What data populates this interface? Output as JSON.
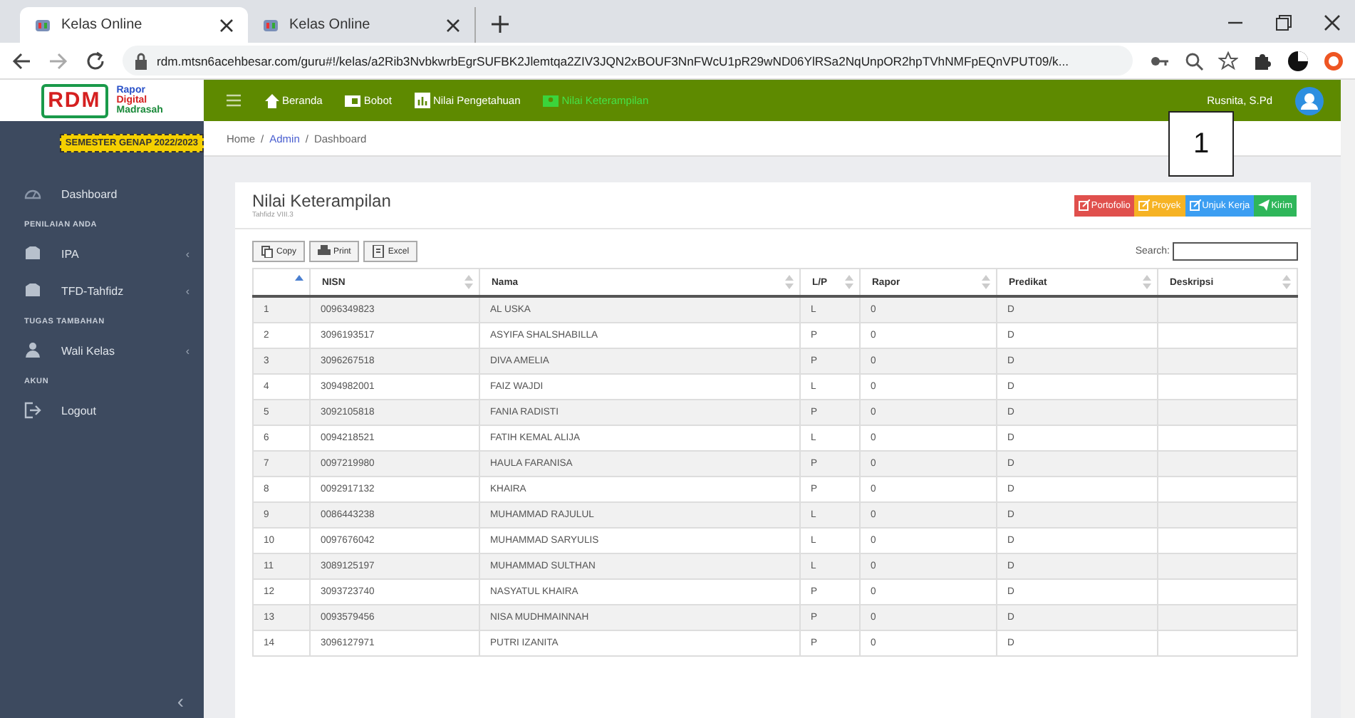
{
  "browser": {
    "tabs": [
      {
        "title": "Kelas Online",
        "selected": true
      },
      {
        "title": "Kelas Online",
        "selected": false
      }
    ],
    "url": "rdm.mtsn6acehbesar.com/guru#!/kelas/a2Rib3NvbkwrbEgrSUFBK2Jlemtqa2ZIV3JQN2xBOUF3NnFWcU1pR29wND06YlRSa2NqUnpOR2hpTVhNMFpEQnVPUT09/k..."
  },
  "header": {
    "logo_letters": "RDM",
    "logo_lines": [
      "Rapor",
      "Digital",
      "Madrasah"
    ],
    "nav": [
      {
        "label": "Beranda",
        "selected": false
      },
      {
        "label": "Bobot",
        "selected": false
      },
      {
        "label": "Nilai Pengetahuan",
        "selected": false
      },
      {
        "label": "Nilai Keterampilan",
        "selected": true
      }
    ],
    "user": "Rusnita, S.Pd"
  },
  "sidebar": {
    "semester": "SEMESTER GENAP 2022/2023",
    "items": [
      {
        "kind": "link",
        "label": "Dashboard"
      },
      {
        "kind": "section",
        "label": "PENILAIAN ANDA"
      },
      {
        "kind": "group",
        "label": "IPA",
        "chevron": "‹"
      },
      {
        "kind": "group",
        "label": "TFD-Tahfidz",
        "chevron": "‹"
      },
      {
        "kind": "section",
        "label": "TUGAS TAMBAHAN"
      },
      {
        "kind": "group",
        "label": "Wali Kelas",
        "chevron": "‹"
      },
      {
        "kind": "section",
        "label": "AKUN"
      },
      {
        "kind": "logout",
        "label": "Logout"
      }
    ],
    "collapse": "‹"
  },
  "breadcrumb": {
    "items": [
      "Home",
      "Admin",
      "Dashboard"
    ],
    "separator": "/"
  },
  "callout": "1",
  "card": {
    "title": "Nilai Keterampilan",
    "subtitle": "Tahfidz VIII.3",
    "actions": [
      {
        "label": "Portofolio",
        "color": "#e0504d"
      },
      {
        "label": "Proyek",
        "color": "#f6b324"
      },
      {
        "label": "Unjuk Kerja",
        "color": "#3c9ef2"
      },
      {
        "label": "Kirim",
        "color": "#2fb65a"
      }
    ],
    "export": [
      "Copy",
      "Print",
      "Excel"
    ],
    "search": {
      "label": "Search:"
    },
    "table": {
      "columns": [
        {
          "sorted": true
        },
        {
          "label": "NISN",
          "sorted": false
        },
        {
          "label": "Nama",
          "sorted": false
        },
        {
          "label": "L/P",
          "sorted": false
        },
        {
          "label": "Rapor",
          "sorted": false
        },
        {
          "label": "Predikat",
          "sorted": false
        },
        {
          "label": "Deskripsi",
          "sorted": false
        }
      ],
      "rows": [
        [
          "1",
          "0096349823",
          "AL USKA",
          "L",
          "0",
          "D"
        ],
        [
          "2",
          "3096193517",
          "ASYIFA SHALSHABILLA",
          "P",
          "0",
          "D"
        ],
        [
          "3",
          "3096267518",
          "DIVA AMELIA",
          "P",
          "0",
          "D"
        ],
        [
          "4",
          "3094982001",
          "FAIZ WAJDI",
          "L",
          "0",
          "D"
        ],
        [
          "5",
          "3092105818",
          "FANIA RADISTI",
          "P",
          "0",
          "D"
        ],
        [
          "6",
          "0094218521",
          "FATIH KEMAL ALIJA",
          "L",
          "0",
          "D"
        ],
        [
          "7",
          "0097219980",
          "HAULA FARANISA",
          "P",
          "0",
          "D"
        ],
        [
          "8",
          "0092917132",
          "KHAIRA",
          "P",
          "0",
          "D"
        ],
        [
          "9",
          "0086443238",
          "MUHAMMAD RAJULUL",
          "L",
          "0",
          "D"
        ],
        [
          "10",
          "0097676042",
          "MUHAMMAD SARYULIS",
          "L",
          "0",
          "D"
        ],
        [
          "11",
          "3089125197",
          "MUHAMMAD SULTHAN",
          "L",
          "0",
          "D"
        ],
        [
          "12",
          "3093723740",
          "NASYATUL KHAIRA",
          "P",
          "0",
          "D"
        ],
        [
          "13",
          "0093579456",
          "NISA MUDHMAINNAH",
          "P",
          "0",
          "D"
        ],
        [
          "14",
          "3096127971",
          "PUTRI IZANITA",
          "P",
          "0",
          "D"
        ]
      ]
    }
  }
}
